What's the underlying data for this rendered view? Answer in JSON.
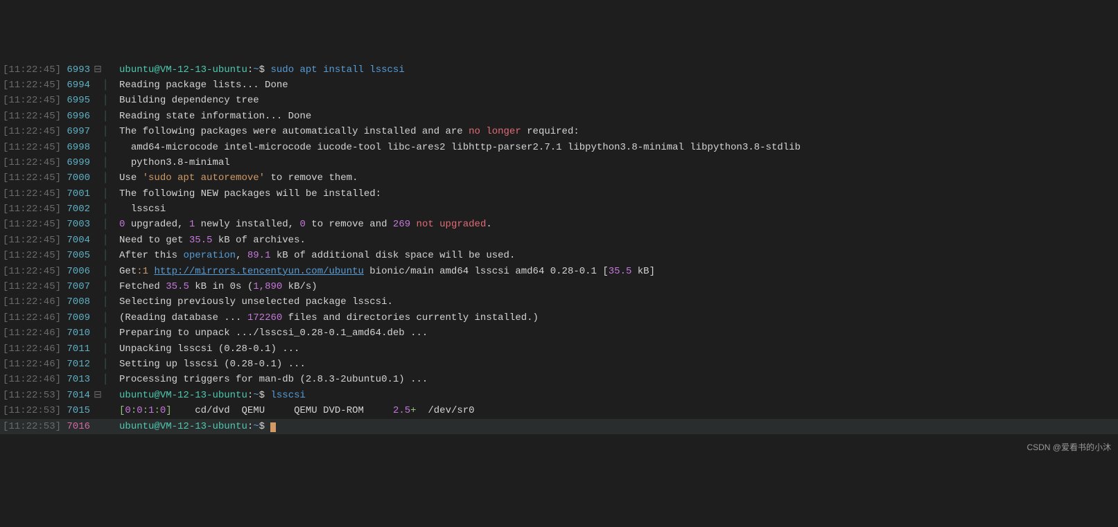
{
  "watermark": "CSDN @爱看书的小沐",
  "lines": [
    {
      "ts": "[11:22:45]",
      "no": "6993",
      "fold": "⊟",
      "segments": [
        {
          "cls": "prompt-user",
          "t": "ubuntu@VM-12-13-ubuntu"
        },
        {
          "cls": "white",
          "t": ":"
        },
        {
          "cls": "cmd",
          "t": "~"
        },
        {
          "cls": "white",
          "t": "$ "
        },
        {
          "cls": "cmd",
          "t": "sudo apt install lsscsi"
        }
      ]
    },
    {
      "ts": "[11:22:45]",
      "no": "6994",
      "segments": [
        {
          "cls": "white",
          "t": "Reading package lists... Done"
        }
      ]
    },
    {
      "ts": "[11:22:45]",
      "no": "6995",
      "segments": [
        {
          "cls": "white",
          "t": "Building dependency tree"
        }
      ]
    },
    {
      "ts": "[11:22:45]",
      "no": "6996",
      "segments": [
        {
          "cls": "white",
          "t": "Reading state information... Done"
        }
      ]
    },
    {
      "ts": "[11:22:45]",
      "no": "6997",
      "segments": [
        {
          "cls": "white",
          "t": "The following packages were automatically installed and are "
        },
        {
          "cls": "red",
          "t": "no longer"
        },
        {
          "cls": "white",
          "t": " required:"
        }
      ]
    },
    {
      "ts": "[11:22:45]",
      "no": "6998",
      "segments": [
        {
          "cls": "white",
          "t": "  amd64-microcode intel-microcode iucode-tool libc-ares2 libhttp-parser2.7.1 libpython3.8-minimal libpython3.8-stdlib"
        }
      ]
    },
    {
      "ts": "[11:22:45]",
      "no": "6999",
      "segments": [
        {
          "cls": "white",
          "t": "  python3.8-minimal"
        }
      ]
    },
    {
      "ts": "[11:22:45]",
      "no": "7000",
      "segments": [
        {
          "cls": "white",
          "t": "Use "
        },
        {
          "cls": "orange",
          "t": "'sudo apt autoremove'"
        },
        {
          "cls": "white",
          "t": " to remove them."
        }
      ]
    },
    {
      "ts": "[11:22:45]",
      "no": "7001",
      "segments": [
        {
          "cls": "white",
          "t": "The following NEW packages will be installed:"
        }
      ]
    },
    {
      "ts": "[11:22:45]",
      "no": "7002",
      "segments": [
        {
          "cls": "white",
          "t": "  lsscsi"
        }
      ]
    },
    {
      "ts": "[11:22:45]",
      "no": "7003",
      "segments": [
        {
          "cls": "magenta",
          "t": "0"
        },
        {
          "cls": "white",
          "t": " upgraded, "
        },
        {
          "cls": "magenta",
          "t": "1"
        },
        {
          "cls": "white",
          "t": " newly installed, "
        },
        {
          "cls": "magenta",
          "t": "0"
        },
        {
          "cls": "white",
          "t": " to remove and "
        },
        {
          "cls": "magenta",
          "t": "269"
        },
        {
          "cls": "white",
          "t": " "
        },
        {
          "cls": "red",
          "t": "not upgraded"
        },
        {
          "cls": "white",
          "t": "."
        }
      ]
    },
    {
      "ts": "[11:22:45]",
      "no": "7004",
      "segments": [
        {
          "cls": "white",
          "t": "Need to get "
        },
        {
          "cls": "magenta",
          "t": "35.5"
        },
        {
          "cls": "white",
          "t": " kB of archives."
        }
      ]
    },
    {
      "ts": "[11:22:45]",
      "no": "7005",
      "segments": [
        {
          "cls": "white",
          "t": "After this "
        },
        {
          "cls": "blue",
          "t": "operation"
        },
        {
          "cls": "white",
          "t": ", "
        },
        {
          "cls": "magenta",
          "t": "89.1"
        },
        {
          "cls": "white",
          "t": " kB of additional disk space will be used."
        }
      ]
    },
    {
      "ts": "[11:22:45]",
      "no": "7006",
      "segments": [
        {
          "cls": "white",
          "t": "Get"
        },
        {
          "cls": "orange",
          "t": ":1"
        },
        {
          "cls": "white",
          "t": " "
        },
        {
          "cls": "url",
          "t": "http://mirrors.tencentyun.com/ubuntu"
        },
        {
          "cls": "white",
          "t": " bionic/main amd64 lsscsi amd64 0.28-0.1 ["
        },
        {
          "cls": "magenta",
          "t": "35.5"
        },
        {
          "cls": "white",
          "t": " kB]"
        }
      ]
    },
    {
      "ts": "[11:22:45]",
      "no": "7007",
      "segments": [
        {
          "cls": "white",
          "t": "Fetched "
        },
        {
          "cls": "magenta",
          "t": "35.5"
        },
        {
          "cls": "white",
          "t": " kB in 0s ("
        },
        {
          "cls": "magenta",
          "t": "1,890"
        },
        {
          "cls": "white",
          "t": " kB/s)"
        }
      ]
    },
    {
      "ts": "[11:22:46]",
      "no": "7008",
      "segments": [
        {
          "cls": "white",
          "t": "Selecting previously unselected package lsscsi."
        }
      ]
    },
    {
      "ts": "[11:22:46]",
      "no": "7009",
      "segments": [
        {
          "cls": "white",
          "t": "(Reading database ... "
        },
        {
          "cls": "magenta",
          "t": "172260"
        },
        {
          "cls": "white",
          "t": " files and directories currently installed.)"
        }
      ]
    },
    {
      "ts": "[11:22:46]",
      "no": "7010",
      "segments": [
        {
          "cls": "white",
          "t": "Preparing to unpack .../lsscsi_0.28-0.1_amd64.deb ..."
        }
      ]
    },
    {
      "ts": "[11:22:46]",
      "no": "7011",
      "segments": [
        {
          "cls": "white",
          "t": "Unpacking lsscsi (0.28-0.1) ..."
        }
      ]
    },
    {
      "ts": "[11:22:46]",
      "no": "7012",
      "segments": [
        {
          "cls": "white",
          "t": "Setting up lsscsi (0.28-0.1) ..."
        }
      ]
    },
    {
      "ts": "[11:22:46]",
      "no": "7013",
      "segments": [
        {
          "cls": "white",
          "t": "Processing triggers for man-db (2.8.3-2ubuntu0.1) ..."
        }
      ]
    },
    {
      "ts": "[11:22:53]",
      "no": "7014",
      "fold": "⊟",
      "segments": [
        {
          "cls": "prompt-user",
          "t": "ubuntu@VM-12-13-ubuntu"
        },
        {
          "cls": "white",
          "t": ":"
        },
        {
          "cls": "cmd",
          "t": "~"
        },
        {
          "cls": "white",
          "t": "$ "
        },
        {
          "cls": "cmd",
          "t": "lsscsi"
        }
      ]
    },
    {
      "ts": "[11:22:53]",
      "no": "7015",
      "segments": [
        {
          "cls": "green",
          "t": "["
        },
        {
          "cls": "magenta",
          "t": "0"
        },
        {
          "cls": "green",
          "t": ":"
        },
        {
          "cls": "magenta",
          "t": "0"
        },
        {
          "cls": "green",
          "t": ":"
        },
        {
          "cls": "magenta",
          "t": "1"
        },
        {
          "cls": "green",
          "t": ":"
        },
        {
          "cls": "magenta",
          "t": "0"
        },
        {
          "cls": "green",
          "t": "]"
        },
        {
          "cls": "white",
          "t": "    cd/dvd  QEMU     QEMU DVD-ROM     "
        },
        {
          "cls": "magenta",
          "t": "2.5"
        },
        {
          "cls": "green",
          "t": "+"
        },
        {
          "cls": "white",
          "t": "  /dev/sr0"
        }
      ]
    },
    {
      "ts": "[11:22:53]",
      "no": "7016",
      "active": true,
      "segments": [
        {
          "cls": "prompt-user",
          "t": "ubuntu@VM-12-13-ubuntu"
        },
        {
          "cls": "white",
          "t": ":"
        },
        {
          "cls": "cmd",
          "t": "~"
        },
        {
          "cls": "white",
          "t": "$ "
        }
      ],
      "cursor": true
    }
  ]
}
